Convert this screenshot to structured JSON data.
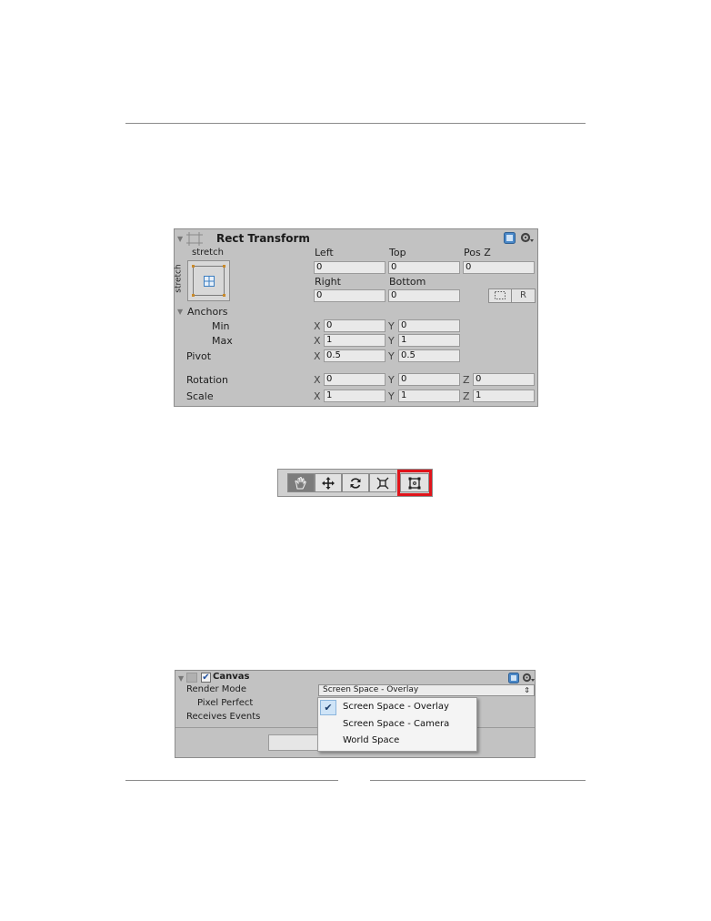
{
  "rect_transform": {
    "title": "Rect Transform",
    "anchor_preset_horizontal": "stretch",
    "anchor_preset_vertical": "stretch",
    "fields": {
      "left_label": "Left",
      "left_value": "0",
      "top_label": "Top",
      "top_value": "0",
      "posz_label": "Pos Z",
      "posz_value": "0",
      "right_label": "Right",
      "right_value": "0",
      "bottom_label": "Bottom",
      "bottom_value": "0"
    },
    "raw_edit_label": "R",
    "anchors": {
      "label": "Anchors",
      "min_label": "Min",
      "min_x": "0",
      "min_y": "0",
      "max_label": "Max",
      "max_x": "1",
      "max_y": "1"
    },
    "pivot": {
      "label": "Pivot",
      "x": "0.5",
      "y": "0.5"
    },
    "rotation": {
      "label": "Rotation",
      "x": "0",
      "y": "0",
      "z": "0"
    },
    "scale": {
      "label": "Scale",
      "x": "1",
      "y": "1",
      "z": "1"
    },
    "axes": {
      "x": "X",
      "y": "Y",
      "z": "Z"
    }
  },
  "toolbar": {
    "tools": [
      "hand-tool",
      "move-tool",
      "rotate-tool",
      "scale-tool",
      "rect-tool"
    ],
    "active": "hand-tool",
    "highlighted": "rect-tool",
    "highlight_color": "#e0141b"
  },
  "canvas": {
    "title": "Canvas",
    "enabled": true,
    "render_mode_label": "Render Mode",
    "render_mode_value": "Screen Space - Overlay",
    "pixel_perfect_label": "Pixel Perfect",
    "receives_events_label": "Receives Events",
    "options": [
      "Screen Space - Overlay",
      "Screen Space - Camera",
      "World Space"
    ],
    "selected_option": "Screen Space - Overlay"
  }
}
